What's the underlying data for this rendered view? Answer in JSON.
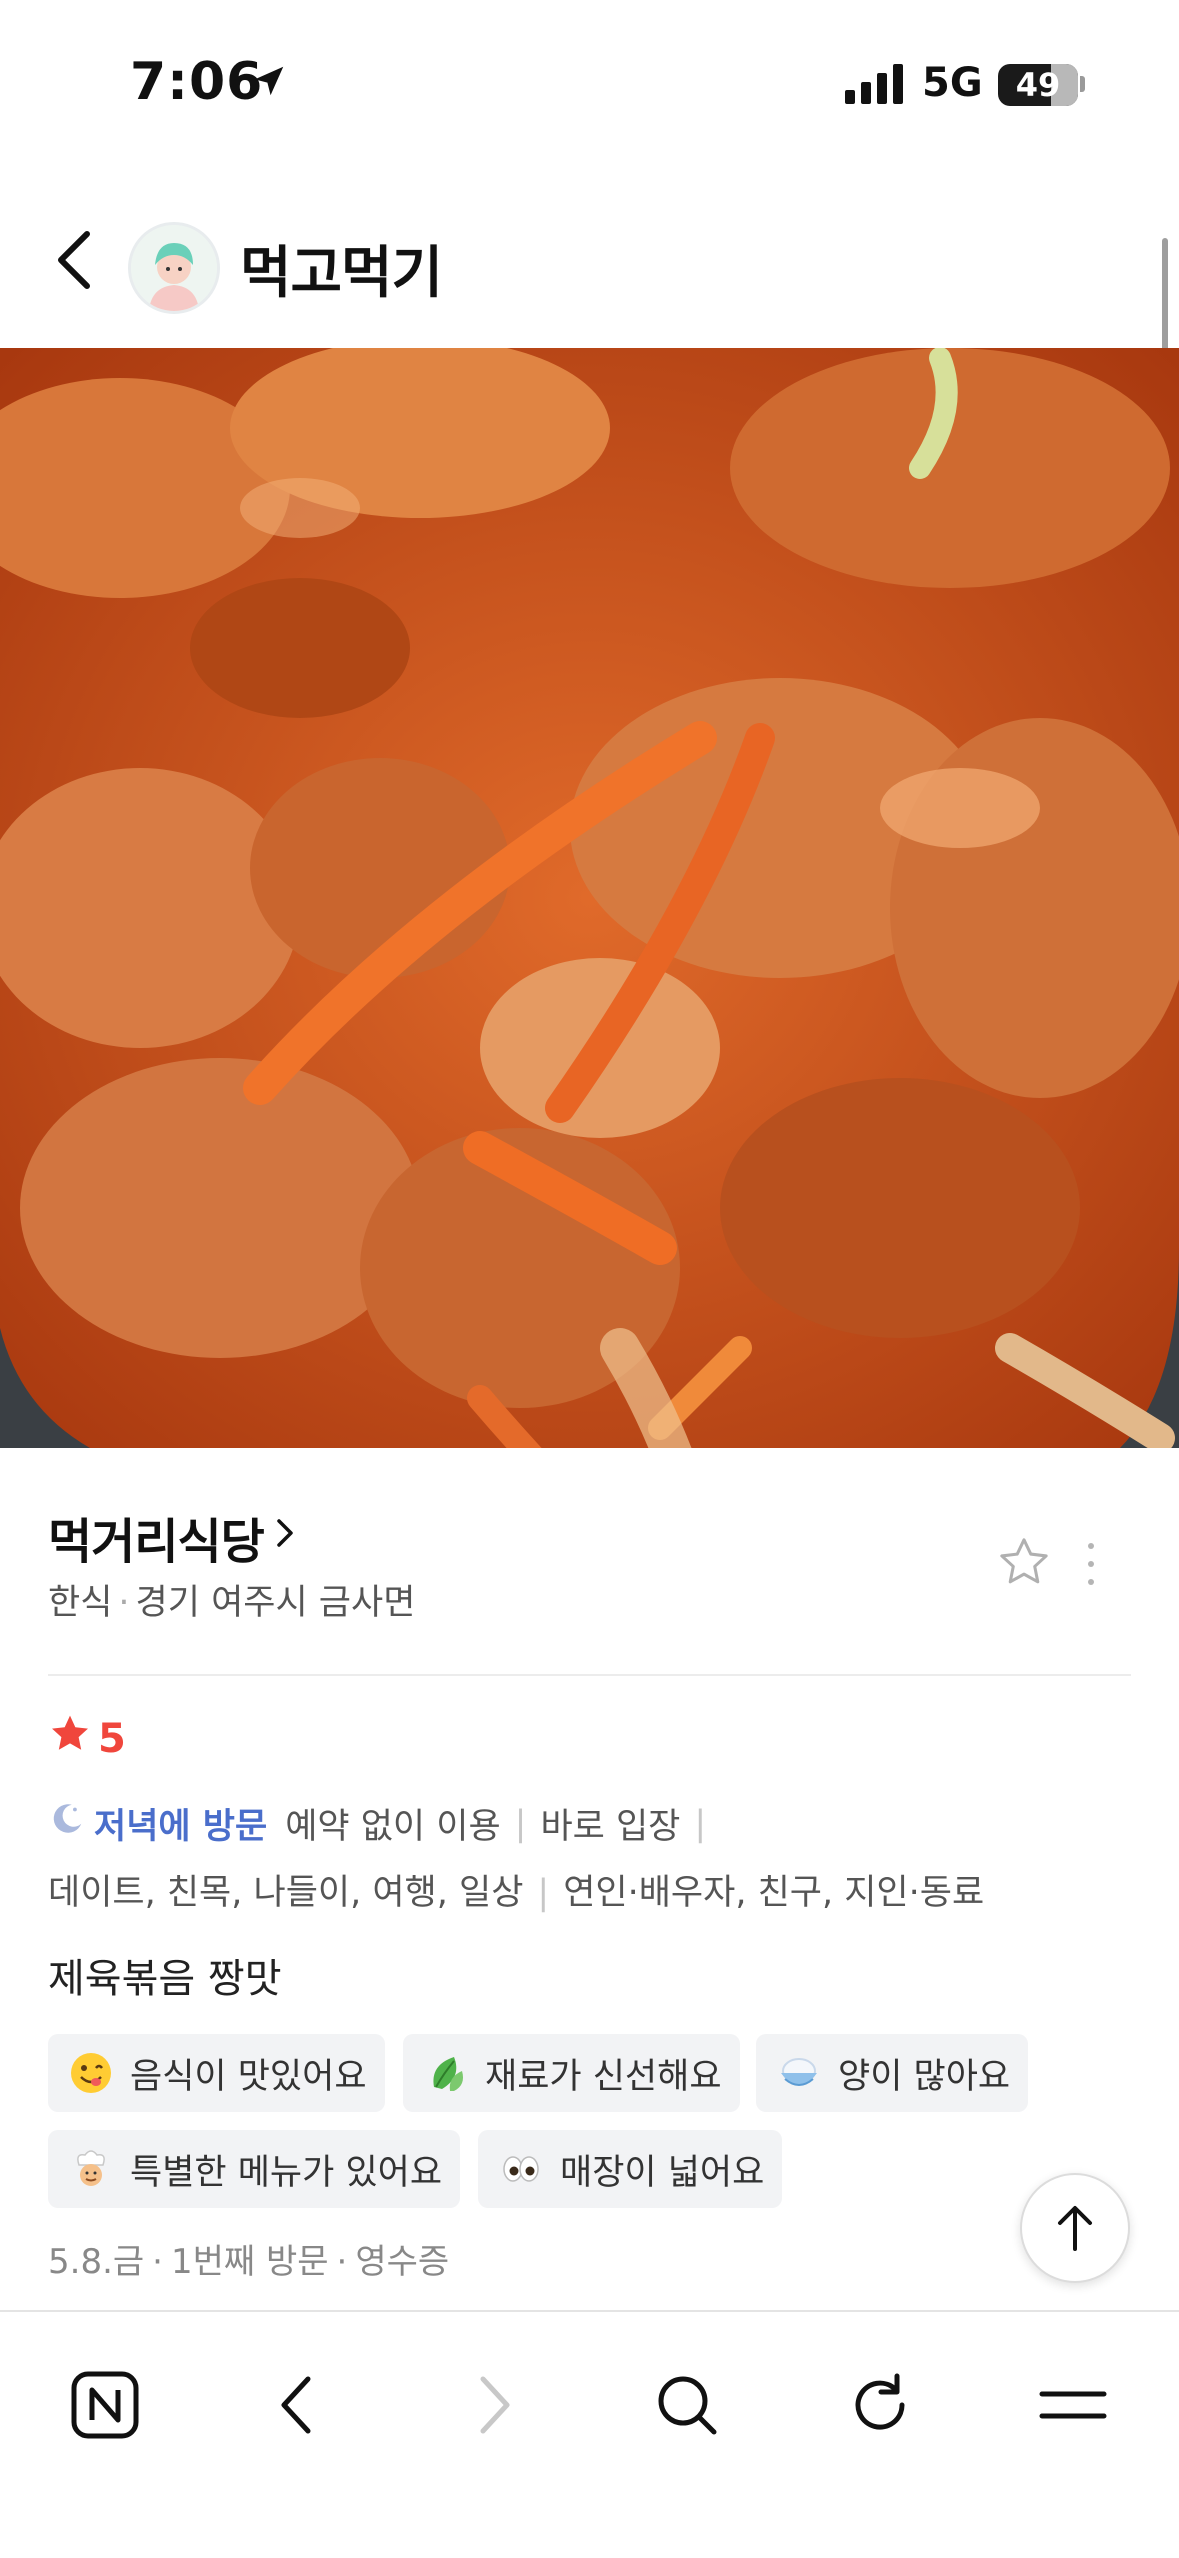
{
  "status_bar": {
    "time": "7:06",
    "network": "5G",
    "battery": "49"
  },
  "header": {
    "title": "먹고먹기"
  },
  "place": {
    "name": "먹거리식당",
    "category": "한식",
    "location": "경기 여주시 금사면"
  },
  "review": {
    "rating": "5",
    "visit_time": "저녁에 방문",
    "visit_details": [
      "예약 없이 이용",
      "바로 입장"
    ],
    "purposes": "데이트, 친목, 나들이, 여행, 일상",
    "companions": "연인·배우자, 친구, 지인·동료",
    "text": "제육볶음 짱맛",
    "tags": [
      {
        "label": "음식이 맛있어요",
        "icon": "yum-face-icon"
      },
      {
        "label": "재료가 신선해요",
        "icon": "leaf-icon"
      },
      {
        "label": "양이 많아요",
        "icon": "rice-bowl-icon"
      },
      {
        "label": "특별한 메뉴가 있어요",
        "icon": "chef-icon"
      },
      {
        "label": "매장이 넓어요",
        "icon": "eyes-icon"
      }
    ],
    "date": "5.8.금",
    "visit_count": "1번째 방문",
    "proof": "영수증"
  },
  "colors": {
    "accent_red": "#f0463c",
    "visit_blue": "#4a6ecb",
    "tag_bg": "#f2f3f5"
  },
  "toolbar": {
    "items": [
      "naver-home-icon",
      "back-icon",
      "forward-icon",
      "search-icon",
      "refresh-icon",
      "menu-icon"
    ]
  }
}
